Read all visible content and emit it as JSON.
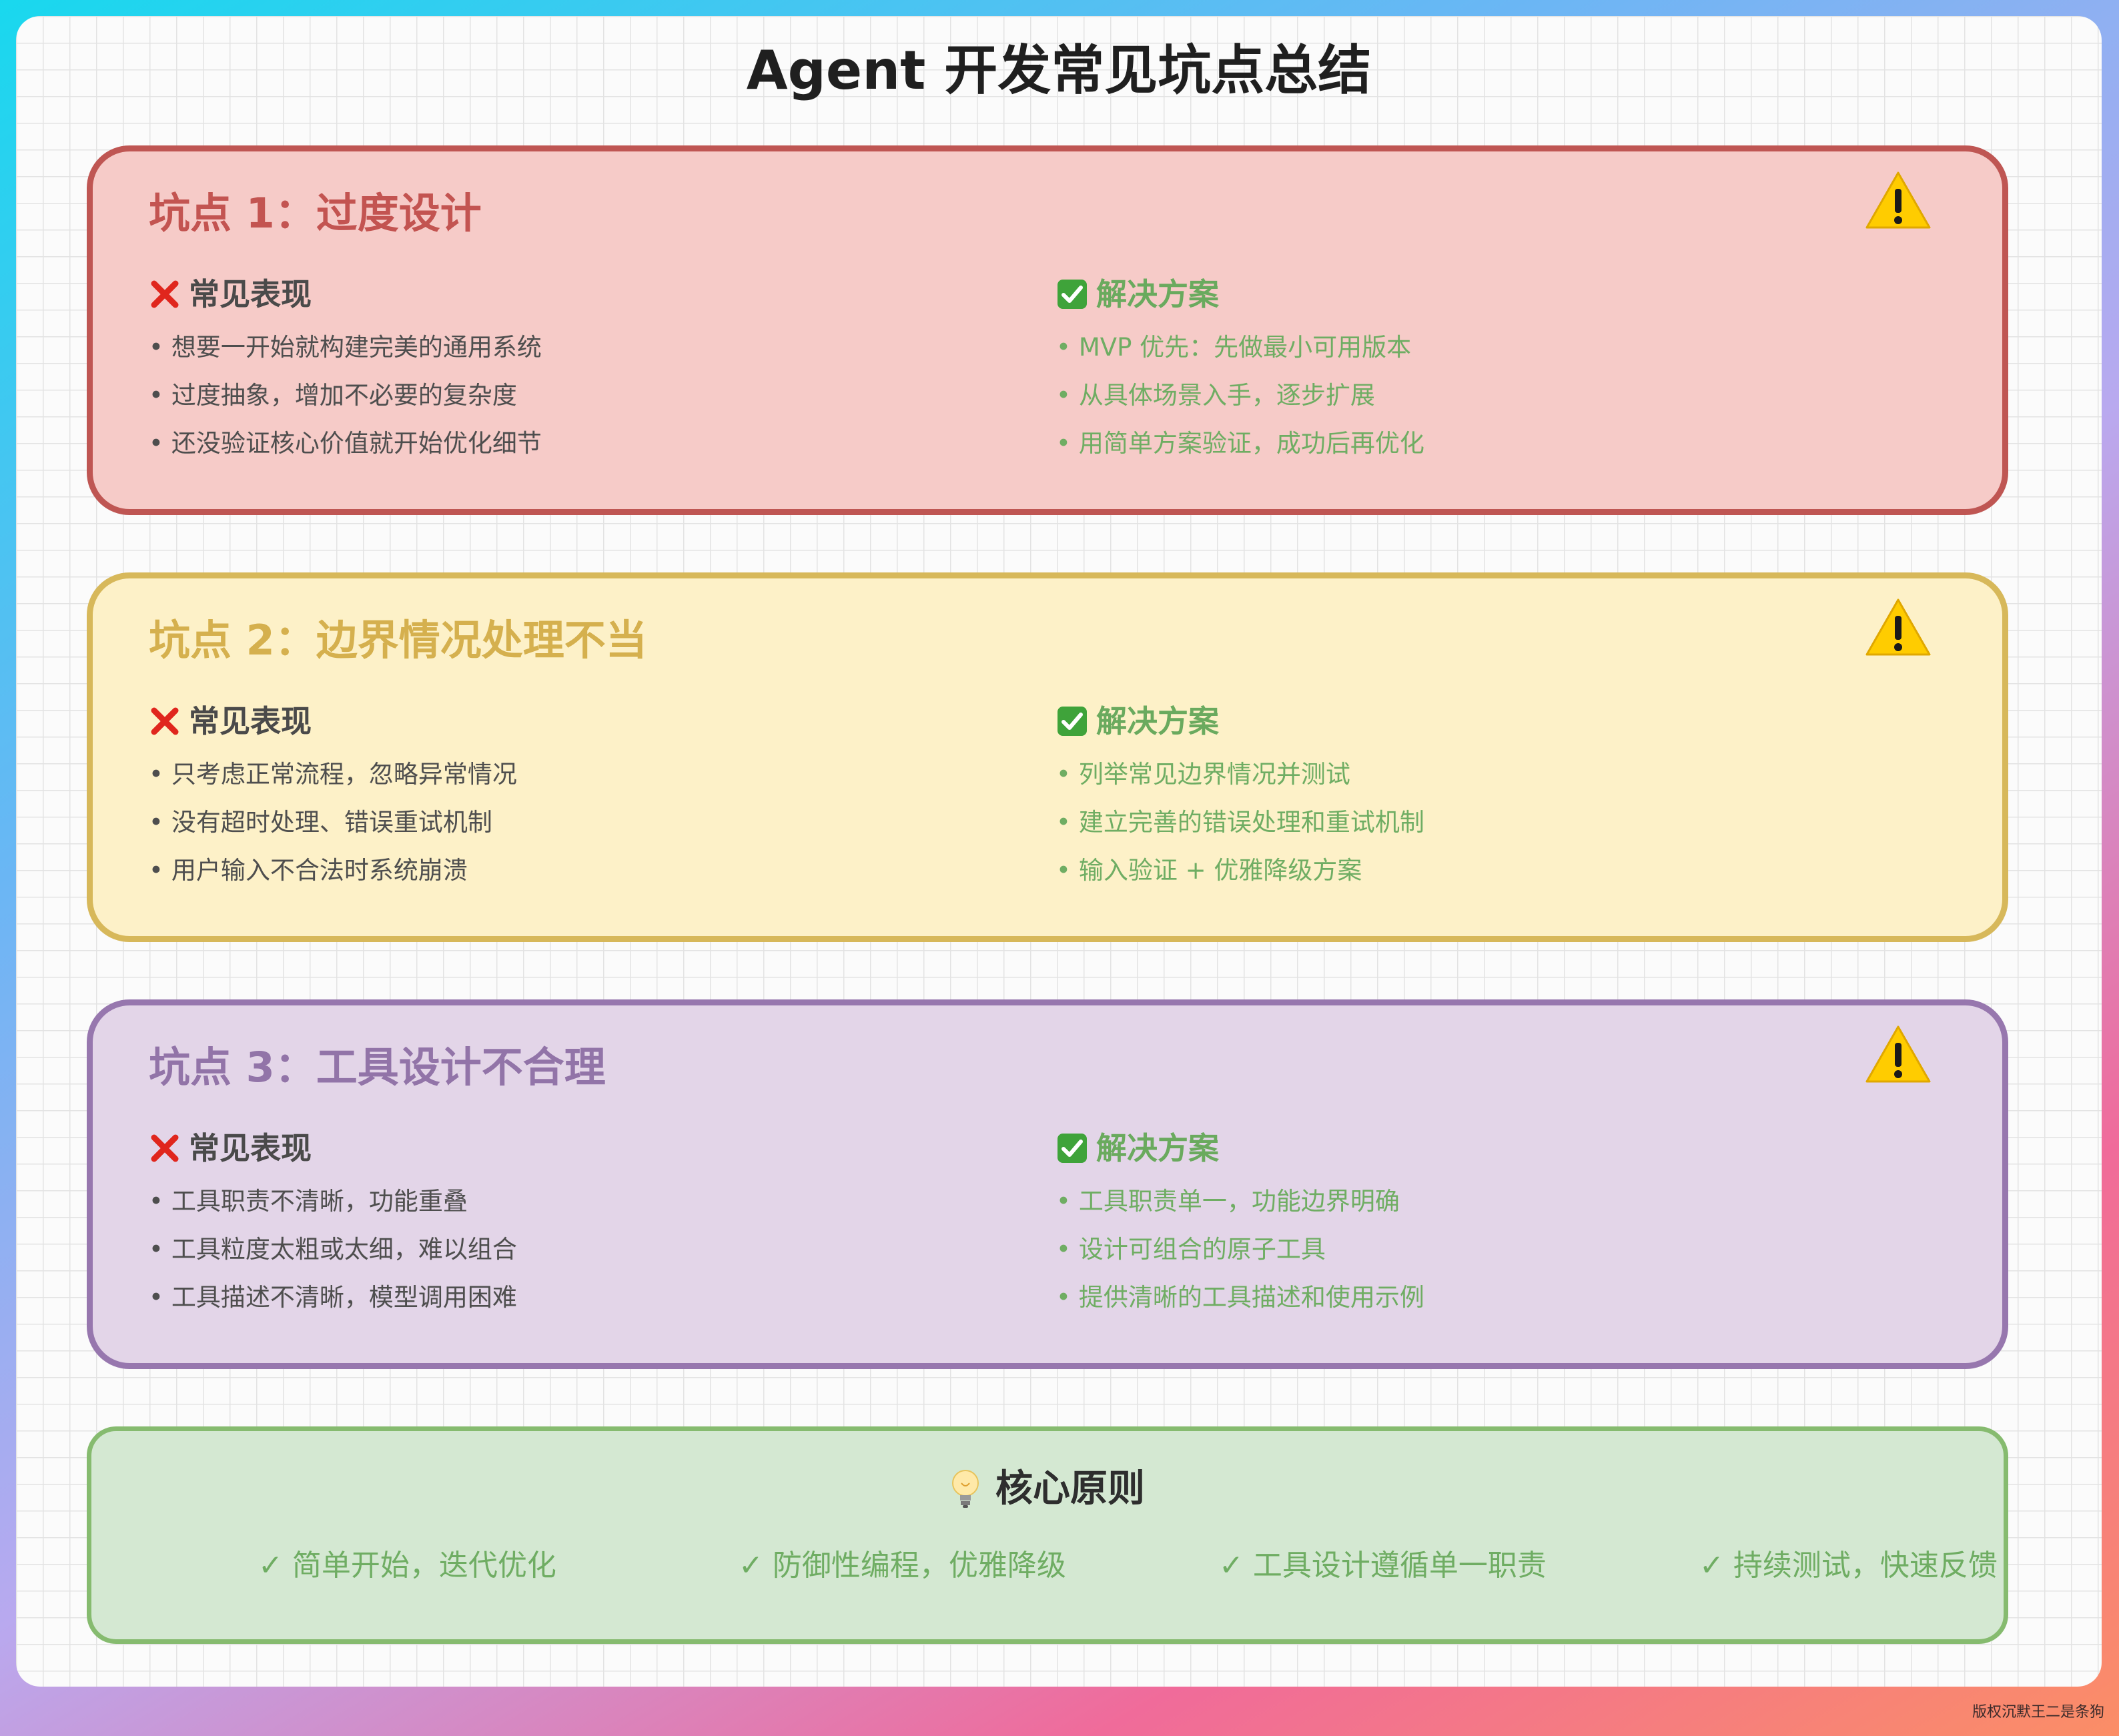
{
  "title": "Agent 开发常见坑点总结",
  "columns": {
    "problem_label": "常见表现",
    "solution_label": "解决方案",
    "problem_icon": "cross-mark-icon",
    "solution_icon": "check-box-icon",
    "bullet": "•"
  },
  "pitfalls": [
    {
      "title": "坑点 1：过度设计",
      "icon": "warning-icon",
      "color": "#c35451",
      "problems": [
        "想要一开始就构建完美的通用系统",
        "过度抽象，增加不必要的复杂度",
        "还没验证核心价值就开始优化细节"
      ],
      "solutions": [
        "MVP 优先：先做最小可用版本",
        "从具体场景入手，逐步扩展",
        "用简单方案验证，成功后再优化"
      ]
    },
    {
      "title": "坑点 2：边界情况处理不当",
      "icon": "warning-icon",
      "color": "#d5b04e",
      "problems": [
        "只考虑正常流程，忽略异常情况",
        "没有超时处理、错误重试机制",
        "用户输入不合法时系统崩溃"
      ],
      "solutions": [
        "列举常见边界情况并测试",
        "建立完善的错误处理和重试机制",
        "输入验证 + 优雅降级方案"
      ]
    },
    {
      "title": "坑点 3：工具设计不合理",
      "icon": "warning-icon",
      "color": "#9274a8",
      "problems": [
        "工具职责不清晰，功能重叠",
        "工具粒度太粗或太细，难以组合",
        "工具描述不清晰，模型调用困难"
      ],
      "solutions": [
        "工具职责单一，功能边界明确",
        "设计可组合的原子工具",
        "提供清晰的工具描述和使用示例"
      ]
    }
  ],
  "principles": {
    "title": "核心原则",
    "icon": "light-bulb-icon",
    "items": [
      "✓ 简单开始，迭代优化",
      "✓ 防御性编程，优雅降级",
      "✓ 工具设计遵循单一职责",
      "✓ 持续测试，快速反馈"
    ]
  },
  "watermark": "版权沉默王二是条狗"
}
